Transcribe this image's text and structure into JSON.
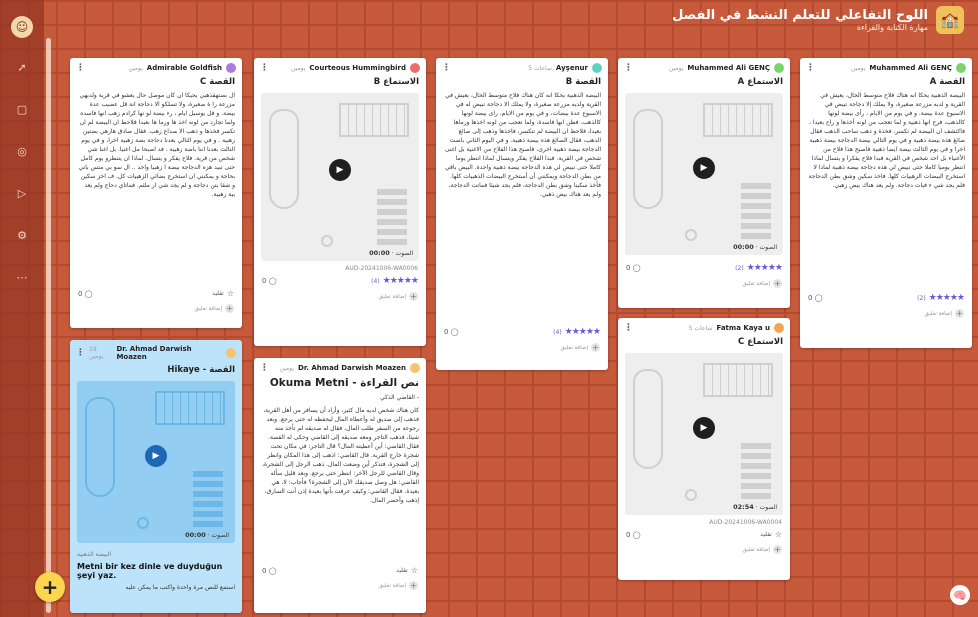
{
  "header": {
    "title": "اللوح التفاعلي للتعلم النشط في الفصل",
    "subtitle": "مهارة الكتابة والقراءة"
  },
  "sidebar": {
    "icons": [
      "share-icon",
      "layout-icon",
      "bell-icon",
      "play-icon",
      "settings-icon",
      "more-icon"
    ],
    "more": "⋯"
  },
  "fab_label": "+",
  "cards": [
    {
      "author": "Muhammed Ali GENÇ",
      "time": "يومين",
      "title": "القصة A",
      "body": "البيضة الذهبية\nيحكا انه هناك فلاح متوسط الحال، يعيش في القرية و لديه مزرعة صغيرة، ولا يملك إلا دجاجة تبيض في الاسبوع عدة بيضة.\nو في يوم من الايام ، رأى بيضة لونها كالذهب، فرح انها ذهبية و لما تعجب من لونه أخذها و راح بعيدا ، فاكتشف ان البيضة لم تكسر. فخذة و ذهب ساحب الذهب فقال صائغ هذه بيضة ذهبية و في يوم التالي بيضة الدجاجة بيضة ذهبية اخرا و في يوم الثالث بيضة ايضا ذهبية فاصبح هذا فلاح من الأغنياء بل احد شخص في القرية فبدا فلاح يفكرا و يتسال لماذا انتظر يوميا كاملا حتى تبيض لي هذه دجاجة بيضة ذهبية لماذا لا استخرج البيضات الزهبيات كلها. فاخذ سكين وشق بطن الدجاجة فلم يجد شي ء فبات دجاجة. ولم يعد هناك بيض زهبي.",
      "rating_count": "(2)",
      "stars": "★★★★★",
      "comments": "0",
      "comment_label": "إضافة تعليق"
    },
    {
      "author": "Muhammed Ali GENÇ",
      "time": "يومين",
      "title": "الاستماع A",
      "duration_label": "الصوت",
      "duration": "00:00",
      "rating_count": "(2)",
      "stars": "★★★★★",
      "comments": "0",
      "comment_label": "إضافة تعليق"
    },
    {
      "author": "Ayşenur",
      "time": "5 ساعات",
      "title": "القصة B",
      "body": "البيضة الذهبية\nيحكا انه كان هناك فلاح متوسط الحال، يعيش في القرية ولديه مزرعة صغيرة، ولا يملك الا دجاجة تبيض له في الاسبوع عدة بيضات، و في يوم من الايام، راى بيضة لونها كالذهب. فظن انها فاسدة، ولما تعجب من لونه اخذها ورماها بعيدا، فلاحظ ان البيضة لم تتكسر، فاخذها وذهب إلى صائغ الذهب، فقال الصائغ هذه بيضة ذهبية. و في اليوم الثاني باضت الدجاجة بيضة ذهبية اخرى، فاصبح هذا الفلاح من الاغنية بل اغنى شخص في القرية. فبدا الفلاح يفكر ويتسال لماذا انتظر يوما كاملا حتى تبيض لي هذه الدجاجة بيضة ذهبية واحدة. البيض باقي من بطن الدجاجة ويمكنني أن أستخرج البيضات الذهبيات كلها. فأخذ سكينا وشق بطن الدجاجة، فلم يجد شيئا فماتت الدجاجة، ولم يعد هناك بيض ذهبي.",
      "rating_count": "(4)",
      "stars": "★★★★★",
      "comments": "0",
      "comment_label": "إضافة تعليق"
    },
    {
      "author": "Courteous Hummingbird",
      "time": "يومين",
      "title": "الاستماع B",
      "duration_label": "الصوت",
      "duration": "00:00",
      "filename": "AUD-20241006-WA0006",
      "rating_count": "(4)",
      "stars": "★★★★★",
      "comments": "0",
      "comment_label": "إضافة تعليق"
    },
    {
      "author": "Admirable Goldfish",
      "time": "يومين",
      "title": "القصة C",
      "body": "ال بضتهقذهبي\nيحيكا ان كان موصل حال يعشو في قرية ولديهي مزرعة را ة صغيرة، ولا تسلكو الا دجاجة انة قل عصيب عدة بيضة. و فل يوسيل ايام ، رء بيضة لو نها كرادم زهب انها فاسده ولما تجارد من لونه اخذ ها ورما ها بعيدا فلاحظ ان البيضة لم ان تكسر فخذها و ذهب الا صداغ زهب. فقال صادق هازهي بضتين زهبية . و في يوم التالي بعدنا دجاجة بضة زهبية اخرا، و في يوم التالث بعدنا اننا باضة زهبية . فد اصبحا مل اغنيا. بل اغنا شي شخص من قرية. فلاح يفكر و يتسال. لماذا ان يتنظرو يوم كامل حتى تبيد هزه الدجاجة بيضة ا زهبيا واحد .. ال سو بي متس باتي بحاجة و يمكنني ان استخرج بضائي الزهبيات كل. ف اخز سكين و شقا بتن دجاجة و لم يجد شي ار ملئم. فماتاي دجاج ولم يعد بية زهبية.",
      "like": "تقليد",
      "comments": "0",
      "comment_label": "إضافة تعليق"
    },
    {
      "author": "Fatma Kaya u",
      "time": "5 ساعات",
      "title": "الاستماع C",
      "duration_label": "الصوت",
      "duration": "02:54",
      "filename": "AUD-20241006-WA0004",
      "like": "تقليد",
      "comments": "0",
      "comment_label": "إضافة تعليق"
    },
    {
      "author": "Dr. Ahmad Darwish Moazen",
      "time": "يومين",
      "title": "نص القراءة - Okuma Metni",
      "subtitle": "- القاضي الذكي",
      "body": "كان هناك شخص لديه مال كثير، وأراد أن يسافر من أهل القرية، فذهب إلى صديق له وأعطاه المال ليحفظه له حتى يرجع. وبعد رجوعه من السفر طلب المال، فقال له صديقه لم تأخذ منه شيئا، فذهب التاجر ومعه صديقه إلى القاضي وحكى له القصة. فقال القاضي: أين أعطيته المال؟ قال التاجر: في مكان تحت شجرة خارج القرية. قال القاضي: اذهب إلى هذا المكان وانظر إلى الشجرة، فتذكر أين وضعت المال. ذهب الرجل إلى الشجرة، وقال القاضي للرجل الآخر: انتظر حتى يرجع. وبعد قليل سأله القاضي: هل وصل صديقك الآن إلى الشجرة؟ فأجاب: لا، هي بعيدة. فقال القاضي: وكيف عرفت بأنها بعيدة إذن أنت السارق، إذهب وأحضر المال.",
      "like": "تقليد",
      "comments": "0",
      "comment_label": "إضافة تعليق"
    },
    {
      "author": "Dr. Ahmad Darwish Moazen",
      "time": "19 يومين",
      "title": "القصة - Hikaye",
      "duration_label": "الصوت",
      "duration": "00:00",
      "sub": "البيضة الذهبية",
      "main_text": "Metni bir kez dinle ve duyduğun şeyi yaz.",
      "ar_text": "استمع للنص مرة واحدة واكتب ما يمكن عليه"
    }
  ],
  "colors": {
    "background": "#c85a3c",
    "accent_star": "#6a59d1",
    "fab": "#ffd54f",
    "blue_card": "#bde3fb"
  }
}
